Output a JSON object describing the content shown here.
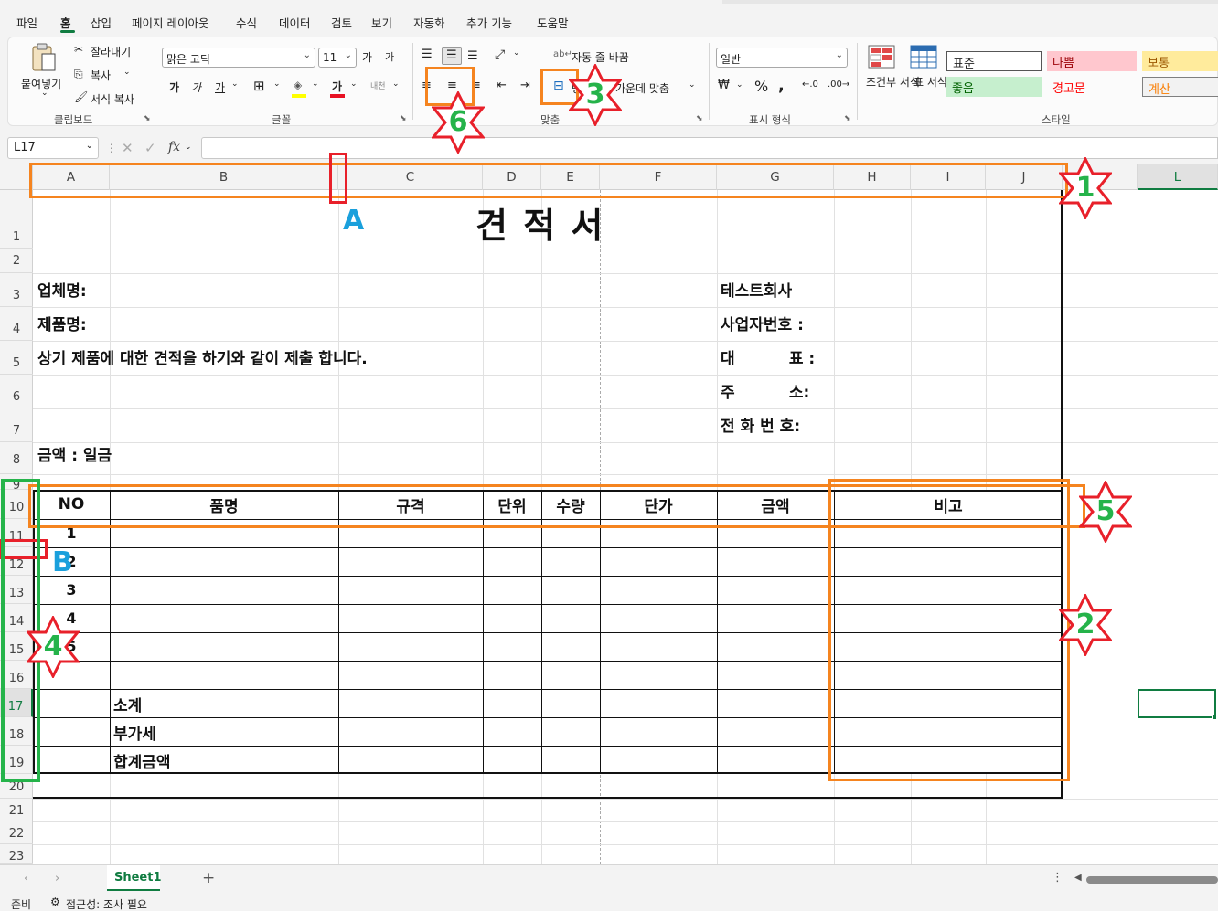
{
  "menu": {
    "items": [
      "파일",
      "홈",
      "삽입",
      "페이지 레이아웃",
      "수식",
      "데이터",
      "검토",
      "보기",
      "자동화",
      "추가 기능",
      "도움말"
    ]
  },
  "ribbon": {
    "clipboard": {
      "paste": "붙여넣기",
      "cut": "잘라내기",
      "copy": "복사",
      "format_painter": "서식 복사",
      "label": "클립보드"
    },
    "font": {
      "name": "맑은 고딕",
      "size": "11",
      "bold": "가",
      "italic": "가",
      "underline": "가",
      "font_color": "가",
      "phonetic": "내천",
      "grow": "가",
      "shrink": "가",
      "label": "글꼴"
    },
    "alignment": {
      "wrap_text": "자동 줄 바꿈",
      "merge_center": "병합하고 가운데 맞춤",
      "label": "맞춤"
    },
    "number": {
      "format": "일반",
      "label": "표시 형식"
    },
    "styles": {
      "conditional": "조건부 서식",
      "table": "표 서식",
      "normal": "표준",
      "bad": "나쁨",
      "neutral": "보통",
      "good": "좋음",
      "warning": "경고문",
      "calc": "계산",
      "label": "스타일"
    }
  },
  "formula_bar": {
    "name_box": "L17",
    "fx": "fx",
    "value": ""
  },
  "columns": [
    "A",
    "B",
    "C",
    "D",
    "E",
    "F",
    "G",
    "H",
    "I",
    "J",
    "L"
  ],
  "rows": [
    "1",
    "2",
    "3",
    "4",
    "5",
    "6",
    "7",
    "8",
    "9",
    "10",
    "11",
    "12",
    "13",
    "14",
    "15",
    "16",
    "17",
    "18",
    "19",
    "20",
    "21",
    "22",
    "23"
  ],
  "sheet": {
    "title": "견 적 서",
    "company_label": "업체명:",
    "product_label": "제품명:",
    "notice": "상기 제품에 대한 견적을 하기와 같이 제출 합니다.",
    "amount_label": "금액 : 일금",
    "vendor_name": "테스트회사",
    "biz_no": "사업자번호 :",
    "rep": "대          표 :",
    "address": "주          소:",
    "phone": "전 화 번 호:",
    "table_headers": [
      "NO",
      "품명",
      "규격",
      "단위",
      "수량",
      "단가",
      "금액",
      "비고"
    ],
    "numbers": [
      "1",
      "2",
      "3",
      "4",
      "5"
    ],
    "subtotal": "소계",
    "vat": "부가세",
    "total": "합계금액"
  },
  "annotations": {
    "stars": [
      "1",
      "2",
      "3",
      "4",
      "5",
      "6"
    ],
    "letters": [
      "A",
      "B"
    ]
  },
  "tabs": {
    "sheet1": "Sheet1",
    "add": "+"
  },
  "status": {
    "ready": "준비",
    "accessibility": "접근성: 조사 필요"
  },
  "colors": {
    "accent": "#107c41",
    "annotation_orange": "#f5841f",
    "annotation_red": "#e8202a",
    "annotation_green": "#25b34a",
    "annotation_blue": "#1aa0dc"
  }
}
